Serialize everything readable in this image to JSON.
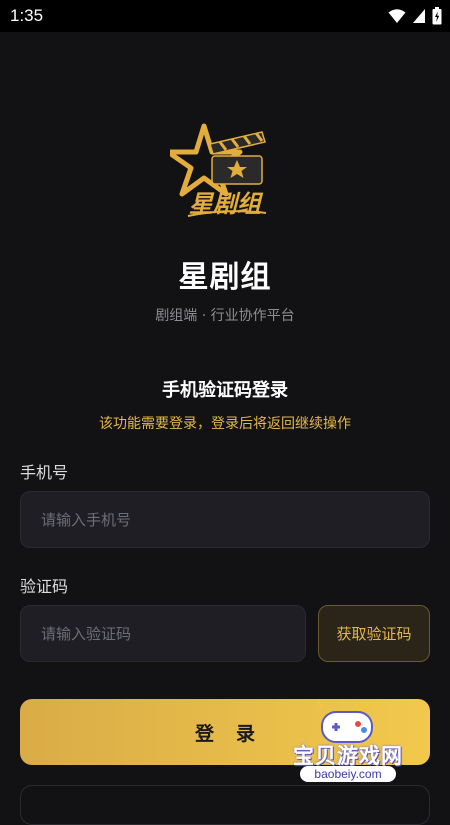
{
  "status_bar": {
    "time": "1:35"
  },
  "app": {
    "logo_text": "星剧组",
    "name": "星剧组",
    "tagline": "剧组端 · 行业协作平台"
  },
  "login": {
    "title": "手机验证码登录",
    "notice": "该功能需要登录，登录后将返回继续操作",
    "phone_label": "手机号",
    "phone_placeholder": "请输入手机号",
    "phone_value": "",
    "code_label": "验证码",
    "code_placeholder": "请输入验证码",
    "code_value": "",
    "get_code_label": "获取验证码",
    "submit_label": "登录"
  },
  "watermark": {
    "text": "宝贝游戏网",
    "url": "baobeiy.com"
  },
  "colors": {
    "background": "#121214",
    "accent": "#e4b84a",
    "button_gradient_start": "#d9ac47",
    "button_gradient_end": "#f2c94c",
    "input_background": "#1e1e24"
  }
}
